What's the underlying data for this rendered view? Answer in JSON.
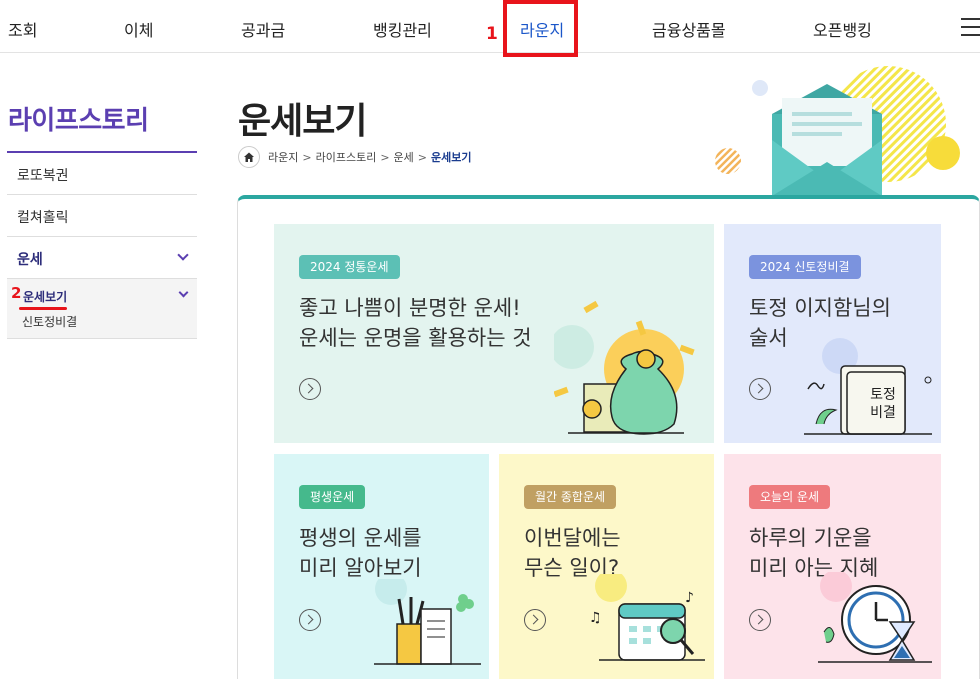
{
  "topnav": {
    "items": [
      "조회",
      "이체",
      "공과금",
      "뱅킹관리",
      "라운지",
      "금융상품몰",
      "오픈뱅킹"
    ],
    "active_index": 4,
    "annotation": "1"
  },
  "sidebar": {
    "title": "라이프스토리",
    "items": [
      "로또복권",
      "컬쳐홀릭",
      "운세"
    ],
    "active": {
      "annotation": "2",
      "label": "운세보기",
      "sub": "신토정비결"
    }
  },
  "page": {
    "title": "운세보기",
    "breadcrumb": [
      "라운지",
      "라이프스토리",
      "운세",
      "운세보기"
    ]
  },
  "cards": [
    {
      "tag": "2024 정통운세",
      "line1": "좋고 나쁨이 분명한 운세!",
      "line2": "운세는 운명을 활용하는 것",
      "bg": "#e3f4ef",
      "tag_color": "#5cc0b5",
      "icon": "money-bag-icon"
    },
    {
      "tag": "2024 신토정비결",
      "line1": "토정 이지함님의",
      "line2": "술서",
      "bg": "#e2e9fb",
      "tag_color": "#7b93de",
      "icon": "book-icon",
      "book_text1": "토정",
      "book_text2": "비결"
    },
    {
      "tag": "평생운세",
      "line1": "평생의 운세를",
      "line2": "미리 알아보기",
      "bg": "#d9f6f6",
      "tag_color": "#45b98c",
      "icon": "pencil-cup-icon"
    },
    {
      "tag": "월간 종합운세",
      "line1": "이번달에는",
      "line2": "무슨 일이?",
      "bg": "#fdf8c9",
      "tag_color": "#c0a062",
      "icon": "calendar-icon"
    },
    {
      "tag": "오늘의 운세",
      "line1": "하루의 기운을",
      "line2": "미리 아는 지혜",
      "bg": "#fde3ea",
      "tag_color": "#ee7a7d",
      "icon": "clock-icon"
    }
  ]
}
